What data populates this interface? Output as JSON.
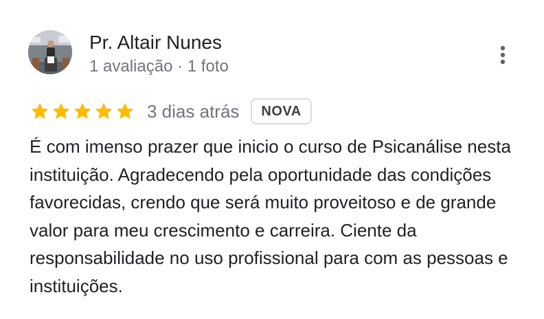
{
  "author": {
    "name": "Pr. Altair Nunes",
    "meta": "1 avaliação · 1 foto",
    "avatar": "avatar-photo"
  },
  "menu": {
    "icon": "more-vert-icon"
  },
  "rating": {
    "stars": 5,
    "max": 5,
    "star_color": "#fbbc04",
    "date": "3 dias atrás",
    "badge": "NOVA"
  },
  "review": {
    "text": "É com imenso prazer que inicio o curso de Psicanálise nesta instituição. Agradecendo pela oportunidade das condições favorecidas, crendo que será muito proveitoso e de grande valor para meu crescimento e carreira. Ciente da responsabilidade no uso profissional para com as pessoas e instituições."
  },
  "colors": {
    "primary_text": "#202124",
    "secondary_text": "#70757a",
    "badge_border": "#dadce0"
  }
}
